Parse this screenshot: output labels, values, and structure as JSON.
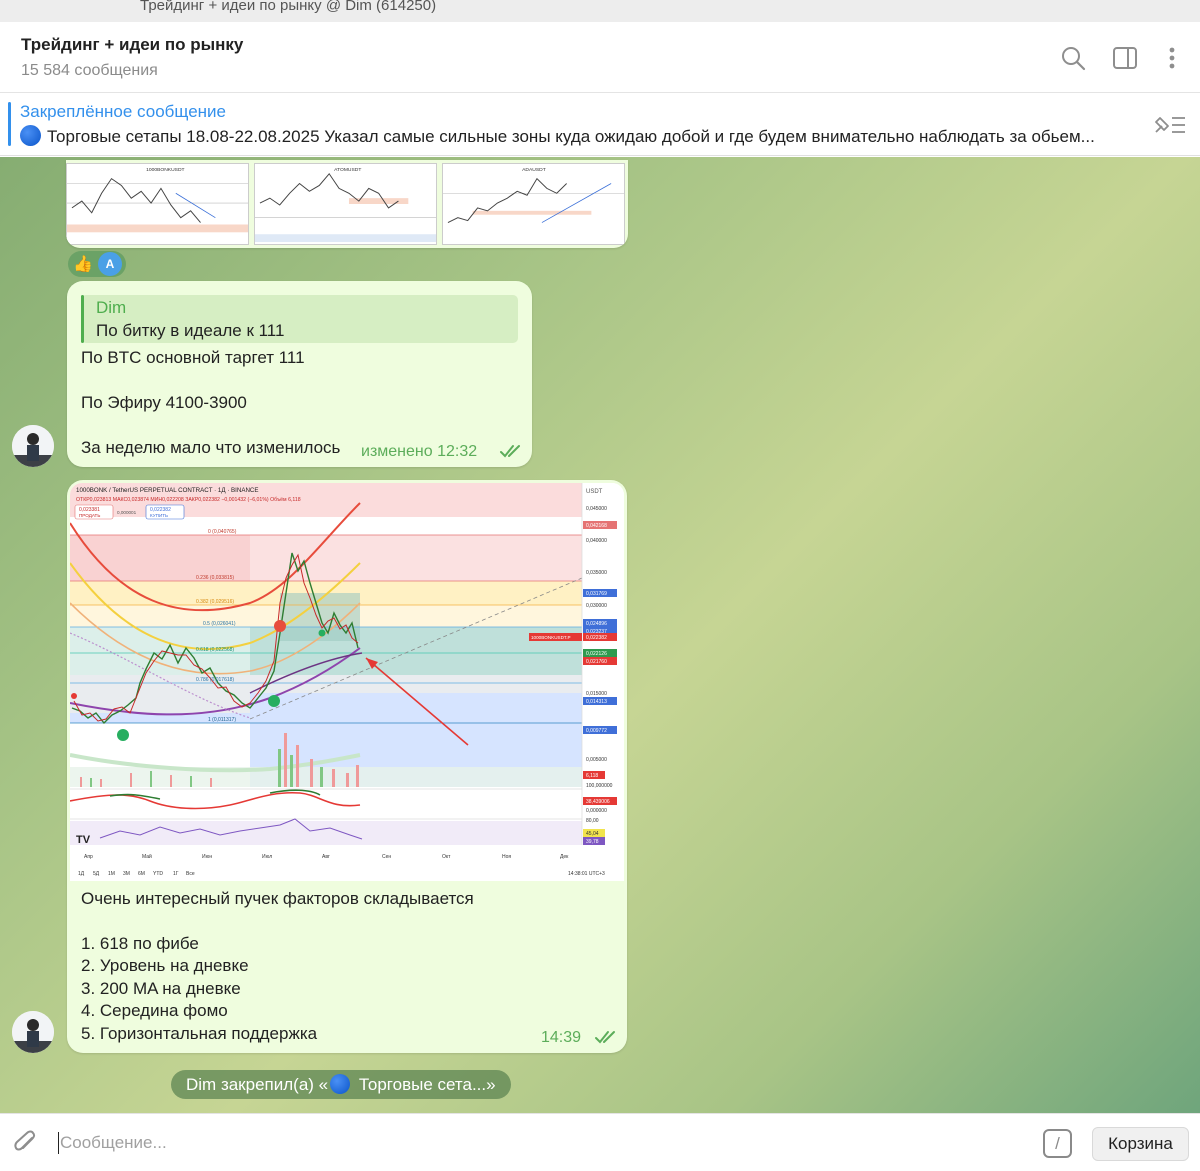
{
  "window": {
    "title": "Трейдинг + идеи по рынку @ Dim (614250)"
  },
  "header": {
    "title": "Трейдинг + идеи по рынку",
    "subtitle": "15 584 сообщения",
    "icons": [
      "search-icon",
      "sidebar-toggle-icon",
      "more-vertical-icon"
    ]
  },
  "pinned": {
    "title": "Закреплённое сообщение",
    "text": "Торговые сетапы 18.08-22.08.2025  Указал самые сильные зоны куда ожидаю добой и где будем внимательно наблюдать за обьем...",
    "icon": "pinned-list-icon"
  },
  "thumbnails": {
    "items": [
      {
        "label": "1000BONKUSDT"
      },
      {
        "label": "ATOMUSDT"
      },
      {
        "label": "ADAUSDT"
      }
    ]
  },
  "reactions": {
    "emoji": "👍",
    "avatar_letter": "A"
  },
  "message1": {
    "reply_author": "Dim",
    "reply_text": "По битку в идеале к 111",
    "lines": [
      "По BTC основной таргет 111",
      "По Эфиру 4100-3900",
      "За неделю мало что изменилось"
    ],
    "meta": "изменено 12:32"
  },
  "message2": {
    "chart": {
      "header": "1000BONK / TetherUS PERPETUAL CONTRACT · 1Д · BINANCE",
      "ohlc": "ОТКР0,023813 МАКС0,023874 МИН0,022208 ЗАКР0,022382 −0,001432 (−6,01%) Объём 6,118",
      "sell_price": "0,023381",
      "sell_label": "ПРОДАТЬ",
      "spread": "0,000001",
      "buy_price": "0,022382",
      "buy_label": "КУПИТЬ",
      "currency": "USDT",
      "price_labels": [
        "0,045000",
        "0,042168",
        "0,040000",
        "0,035000",
        "0,031769",
        "0,030000",
        "0,024896",
        "0,023237",
        "0,022382",
        "0,022126",
        "0,021760",
        "0,015000",
        "0,014313",
        "0,009772",
        "0,005000",
        "6,118",
        "100,000000",
        "38,439006",
        "0,000000",
        "80,00",
        "45,04",
        "39,78"
      ],
      "symbol_tag": "1000BONKUSDT.P",
      "fib_labels": [
        "0 (0,040765)",
        "0.236 (0,033815)",
        "0.382 (0,029516)",
        "0.5 (0,026041)",
        "0.618 (0,022568)",
        "0.786 (0,017618)",
        "1 (0,011317)"
      ],
      "months": [
        "Апр",
        "Май",
        "Июн",
        "Июл",
        "Авг",
        "Сен",
        "Окт",
        "Ноя",
        "Дек"
      ],
      "ranges": [
        "1Д",
        "5Д",
        "1М",
        "3М",
        "6М",
        "YTD",
        "1Г",
        "Все"
      ],
      "timestamp": "14:38:01 UTC+3"
    },
    "intro": "Очень интересный пучек факторов складывается",
    "points": [
      "1. 618 по фибе",
      "2. Уровень на дневке",
      "3. 200 MA на дневке",
      "4. Середина фомо",
      "5. Горизонтальная поддержка"
    ],
    "meta": "14:39"
  },
  "service": {
    "text_before": "Dim закрепил(а) «",
    "text_after": " Торговые сета...»"
  },
  "composer": {
    "placeholder": "Сообщение...",
    "command_label": "/",
    "tooltip": "Корзина"
  }
}
